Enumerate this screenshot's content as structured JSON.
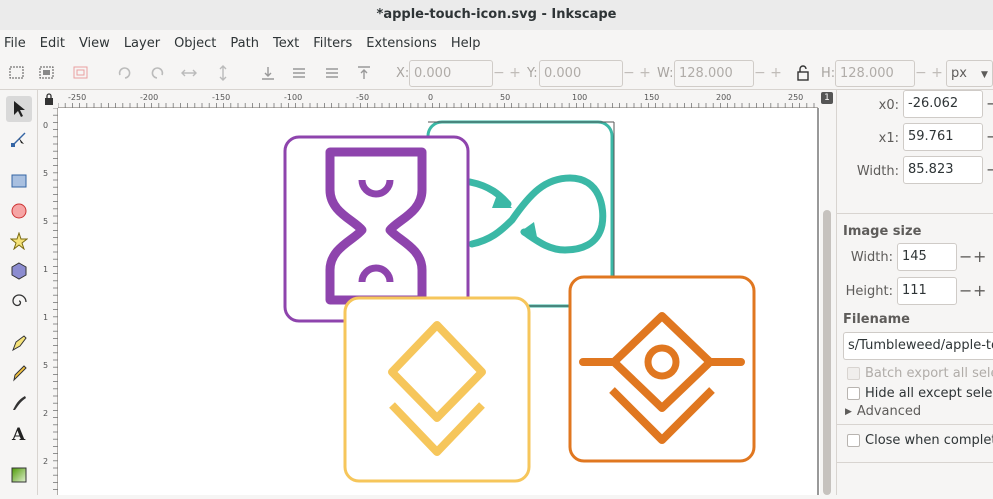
{
  "window": {
    "title": "*apple-touch-icon.svg - Inkscape"
  },
  "menu": [
    "File",
    "Edit",
    "View",
    "Layer",
    "Object",
    "Path",
    "Text",
    "Filters",
    "Extensions",
    "Help"
  ],
  "toolbar": {
    "x_label": "X:",
    "x_value": "0.000",
    "y_label": "Y:",
    "y_value": "0.000",
    "w_label": "W:",
    "w_value": "128.000",
    "h_label": "H:",
    "h_value": "128.000",
    "unit": "px"
  },
  "ruler": {
    "h_ticks": [
      "-250",
      "-200",
      "-150",
      "-100",
      "-50",
      "0",
      "50",
      "100",
      "150",
      "200",
      "250"
    ],
    "v_ticks": [
      "0",
      "5",
      "5",
      "1",
      "1",
      "5",
      "2",
      "2"
    ]
  },
  "export_panel": {
    "x0_label": "x0:",
    "x0_value": "-26.062",
    "x1_label": "x1:",
    "x1_value": "59.761",
    "width_label": "Width:",
    "width_value": "85.823",
    "image_size_heading": "Image size",
    "img_width_label": "Width:",
    "img_width_value": "145",
    "img_height_label": "Height:",
    "img_height_value": "111",
    "filename_heading": "Filename",
    "filename_value": "s/Tumbleweed/apple-touc",
    "batch_export_label": "Batch export all selecte",
    "hide_all_label": "Hide all except selecte",
    "advanced_label": "Advanced",
    "close_when_complete_label": "Close when complete"
  },
  "icons": {
    "purple": "#8e44ad",
    "teal": "#3bb8a6",
    "yellow": "#f6c65b",
    "orange": "#e07720"
  }
}
